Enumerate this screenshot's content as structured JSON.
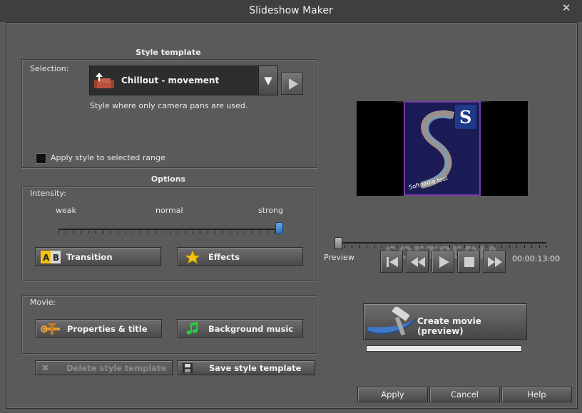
{
  "window": {
    "title": "Slideshow Maker",
    "close_glyph": "✕"
  },
  "style_template": {
    "header": "Style template",
    "selection_label": "Selection:",
    "selected_value": "Chillout - movement",
    "description": "Style where only camera pans are used.",
    "apply_range_label": "Apply style to selected range",
    "apply_range_checked": false
  },
  "options": {
    "header": "Options",
    "intensity_label": "Intensity:",
    "intensity_weak": "weak",
    "intensity_normal": "normal",
    "intensity_strong": "strong",
    "intensity_value": 1.0,
    "transition_label": "Transition",
    "transition_icon_a": "A",
    "transition_icon_b": "B",
    "effects_label": "Effects"
  },
  "movie": {
    "label": "Movie:",
    "properties_label": "Properties & title",
    "background_music_label": "Background music"
  },
  "templates": {
    "delete_label": "Delete style template",
    "save_label": "Save style template"
  },
  "preview": {
    "label": "Preview",
    "timecode": "00:00:13:00",
    "position": 0.0,
    "thumbnail_text": "Softpedia test",
    "thumbnail_letter": "S",
    "watermark": "SOFTPEDIA"
  },
  "create": {
    "label": "Create movie (preview)",
    "progress": 1.0
  },
  "dialog": {
    "apply": "Apply",
    "cancel": "Cancel",
    "help": "Help"
  },
  "icons": [
    "close-icon",
    "template-icon",
    "dropdown-arrow-icon",
    "play-icon",
    "transition-ab-icon",
    "star-icon",
    "tools-icon",
    "music-note-icon",
    "delete-x-icon",
    "save-icon",
    "skip-start-icon",
    "rewind-icon",
    "play-icon",
    "stop-icon",
    "fast-forward-icon",
    "create-movie-icon"
  ],
  "colors": {
    "accent": "#3f78c4",
    "star": "#f4c20d",
    "music": "#2ecc40",
    "ab_yellow": "#f4c20d"
  }
}
